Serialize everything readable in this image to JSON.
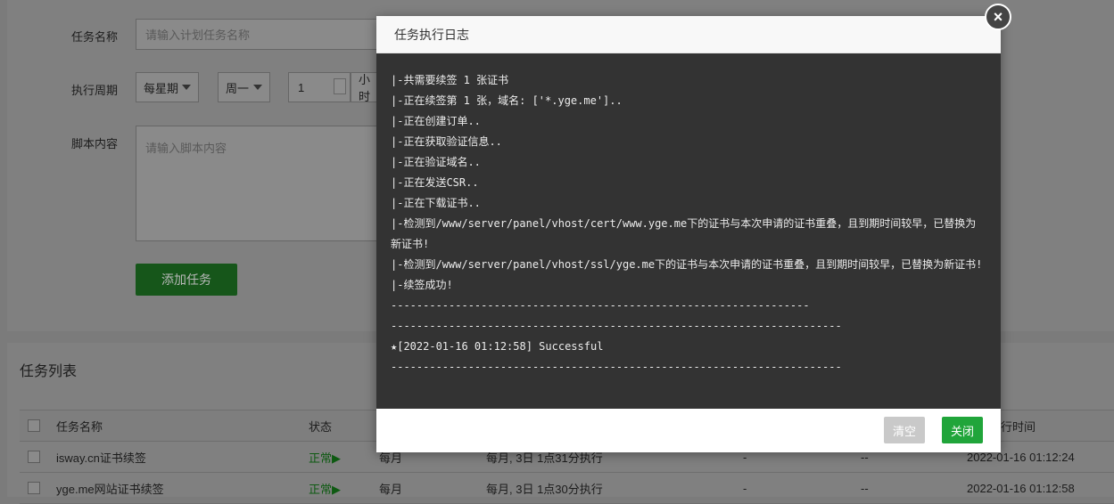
{
  "form": {
    "task_name_label": "任务名称",
    "task_name_placeholder": "请输入计划任务名称",
    "period_label": "执行周期",
    "period_type": "每星期",
    "weekday": "周一",
    "hour_value": "1",
    "hour_unit_partial": "小时",
    "script_label": "脚本内容",
    "script_placeholder": "请输入脚本内容",
    "add_button": "添加任务"
  },
  "task_list": {
    "title": "任务列表",
    "columns": [
      "任务名称",
      "状态",
      "执行时间"
    ],
    "rows": [
      {
        "name": "isway.cn证书续签",
        "status": "正常▶",
        "period": "每月",
        "schedule": "每月, 3日 1点31分执行",
        "c5": "-",
        "c6": "--",
        "time": "2022-01-16 01:12:24"
      },
      {
        "name": "yge.me网站证书续签",
        "status": "正常▶",
        "period": "每月",
        "schedule": "每月, 3日 1点30分执行",
        "c5": "-",
        "c6": "--",
        "time": "2022-01-16 01:12:58"
      }
    ],
    "last_col_header_partial": "行时间"
  },
  "modal": {
    "title": "任务执行日志",
    "log_lines": [
      "|-共需要续签 1 张证书",
      "|-正在续签第 1 张，域名: ['*.yge.me']..",
      "|-正在创建订单..",
      "|-正在获取验证信息..",
      "|-正在验证域名..",
      "|-正在发送CSR..",
      "|-正在下载证书..",
      "|-检测到/www/server/panel/vhost/cert/www.yge.me下的证书与本次申请的证书重叠，且到期时间较早，已替换为新证书!",
      "|-检测到/www/server/panel/vhost/ssl/yge.me下的证书与本次申请的证书重叠，且到期时间较早，已替换为新证书!",
      "|-续签成功!",
      "-----------------------------------------------------------------",
      "----------------------------------------------------------------------",
      "★[2022-01-16 01:12:58] Successful",
      "----------------------------------------------------------------------"
    ],
    "clear_button": "清空",
    "close_button": "关闭",
    "close_icon": "×"
  },
  "colors": {
    "accent_green": "#20a53a",
    "log_background": "#333333",
    "status_ok": "#0e5a12"
  }
}
